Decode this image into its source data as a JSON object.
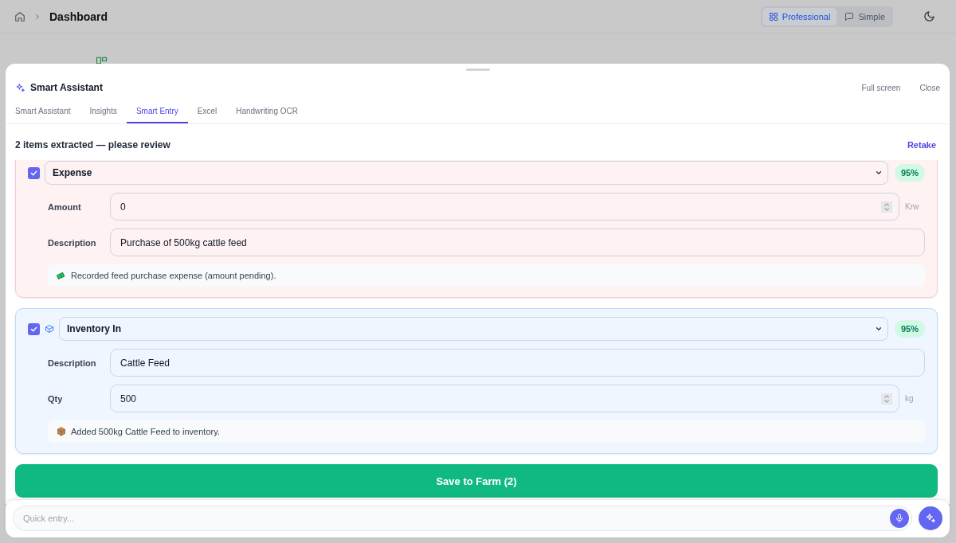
{
  "topbar": {
    "breadcrumb": "Dashboard",
    "modes": [
      {
        "kind": "grid",
        "label": "Professional",
        "selected": true
      },
      {
        "kind": "chat",
        "label": "Simple",
        "selected": false
      }
    ]
  },
  "assistant": {
    "title": "Smart Assistant",
    "actions": [
      "Full screen",
      "Close"
    ],
    "tabs": [
      {
        "label": "Smart Assistant",
        "selected": false
      },
      {
        "label": "Insights",
        "selected": false
      },
      {
        "label": "Smart Entry",
        "selected": true
      },
      {
        "label": "Excel",
        "selected": false
      },
      {
        "label": "Handwriting OCR",
        "selected": false
      }
    ],
    "summary": "2 items extracted — please review",
    "retake": "Retake",
    "entries": [
      {
        "kind": "expense",
        "checked": true,
        "type": "Expense",
        "confidence": "95%",
        "fields": [
          {
            "label": "Amount",
            "kind": "number",
            "value": "0",
            "unit": "Krw"
          },
          {
            "label": "Description",
            "kind": "text",
            "value": "Purchase of 500kg cattle feed"
          }
        ],
        "note": "Recorded feed purchase expense (amount pending)."
      },
      {
        "kind": "inventory_in",
        "checked": true,
        "type": "Inventory In",
        "confidence": "95%",
        "fields": [
          {
            "label": "Description",
            "kind": "text",
            "value": "Cattle Feed"
          },
          {
            "label": "Qty",
            "kind": "number",
            "value": "500",
            "unit": "kg"
          }
        ],
        "note": "Added 500kg Cattle Feed to inventory."
      }
    ],
    "save_button": "Save to Farm (2)"
  },
  "quick_entry": {
    "placeholder": "Quick entry..."
  }
}
